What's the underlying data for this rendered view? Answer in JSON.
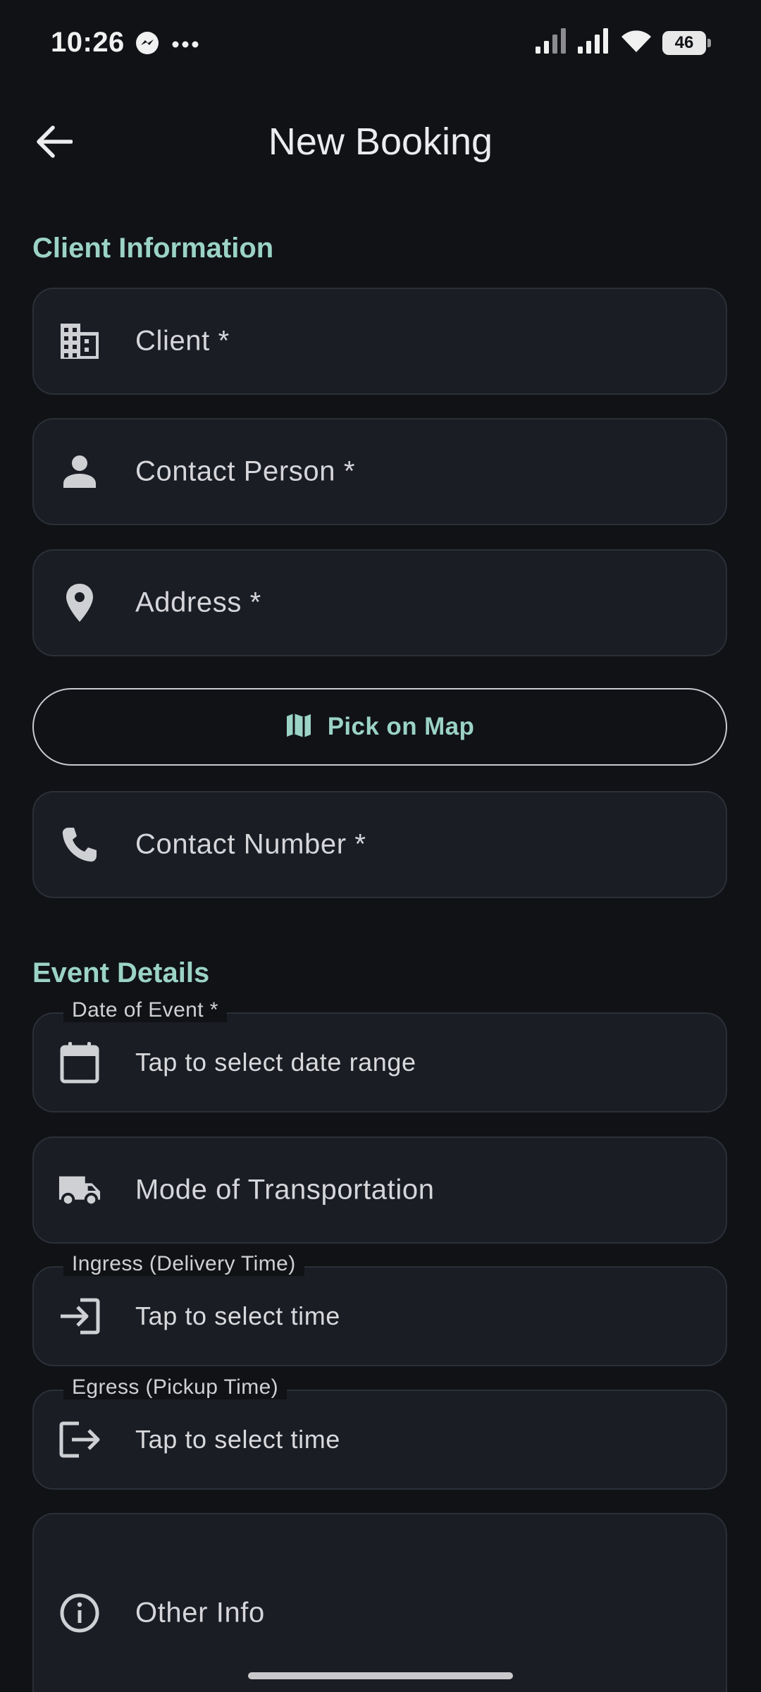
{
  "status_bar": {
    "time": "10:26",
    "battery_level": "46",
    "notification_icons": [
      "messenger-icon",
      "more-dots-icon"
    ],
    "system_icons": [
      "signal-icon",
      "signal-icon",
      "wifi-icon",
      "battery-icon"
    ]
  },
  "app_bar": {
    "title": "New Booking",
    "back_icon": "arrow-back-icon"
  },
  "client_section": {
    "title": "Client Information",
    "client_field": {
      "placeholder": "Client *",
      "icon": "building-icon"
    },
    "contact_person_field": {
      "placeholder": "Contact Person *",
      "icon": "person-icon"
    },
    "address_field": {
      "placeholder": "Address *",
      "icon": "location-pin-icon"
    },
    "map_button": {
      "label": "Pick on Map",
      "icon": "map-icon"
    },
    "contact_number_field": {
      "placeholder": "Contact Number *",
      "icon": "phone-icon"
    }
  },
  "event_section": {
    "title": "Event Details",
    "date_field": {
      "label": "Date of Event *",
      "value": "Tap to select date range",
      "icon": "calendar-icon"
    },
    "transport_field": {
      "placeholder": "Mode of Transportation",
      "icon": "truck-icon"
    },
    "ingress_field": {
      "label": "Ingress (Delivery Time)",
      "value": "Tap to select time",
      "icon": "login-icon"
    },
    "egress_field": {
      "label": "Egress (Pickup Time)",
      "value": "Tap to select time",
      "icon": "logout-icon"
    },
    "other_info_field": {
      "placeholder": "Other Info",
      "icon": "info-icon"
    }
  },
  "colors": {
    "background": "#101216",
    "field_background": "#1a1d24",
    "field_border": "#2b2f37",
    "accent": "#9bd3c6",
    "text": "#d6d6da"
  }
}
